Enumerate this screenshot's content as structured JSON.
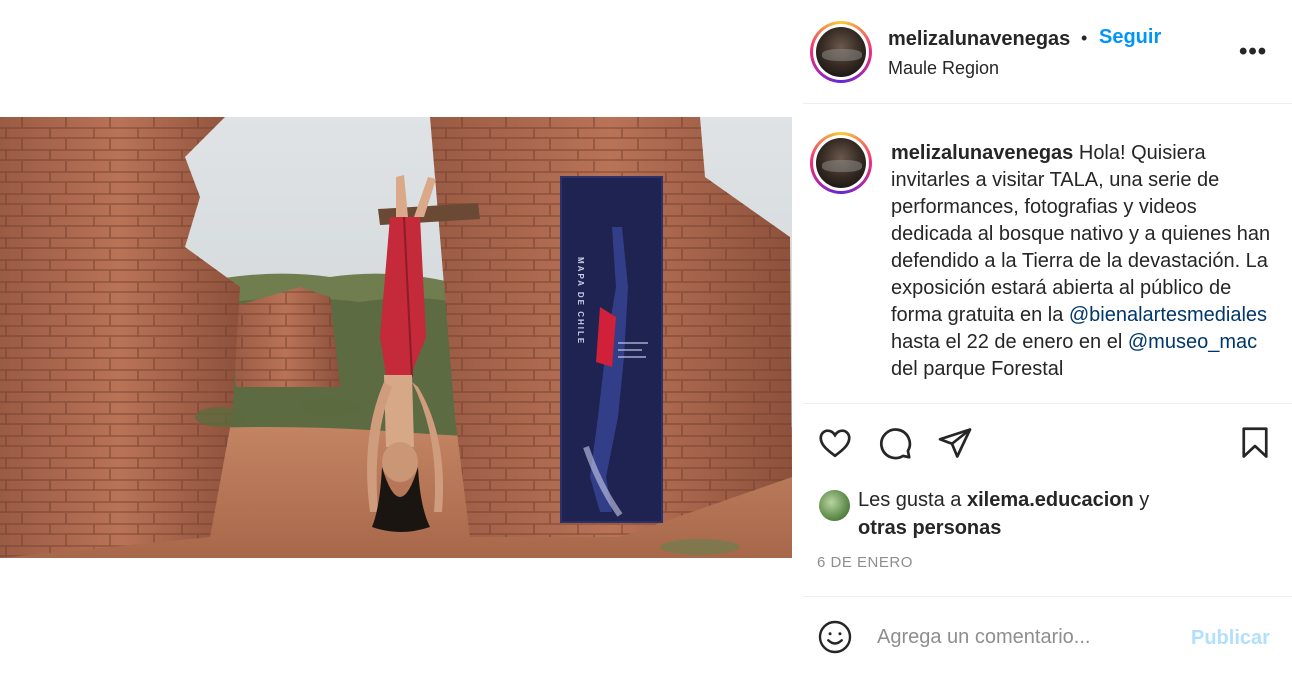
{
  "post": {
    "username": "melizalunavenegas",
    "follow_label": "Seguir",
    "separator": "•",
    "location": "Maule Region",
    "more_label": "•••"
  },
  "caption": {
    "username": "melizalunavenegas",
    "text_part1": " Hola! Quisiera invitarles a visitar TALA, una serie de performances, fotografias y videos dedicada al bosque nativo y a quienes han defendido a la Tierra de la devastación. La exposición estará abierta al público de forma gratuita en la ",
    "mention1": "@bienalartesmediales",
    "text_part2": " hasta el 22 de enero en el ",
    "mention2": "@museo_mac",
    "text_part3": " del parque Forestal"
  },
  "media": {
    "banner_title": "MAPA DE CHILE"
  },
  "likes": {
    "prefix": "Les gusta a ",
    "user": "xilema.educacion",
    "middle": " y",
    "others": "otras personas"
  },
  "date": "6 DE ENERO",
  "comment": {
    "placeholder": "Agrega un comentario...",
    "publish_label": "Publicar"
  },
  "colors": {
    "accent": "#0095f6",
    "link": "#00376b",
    "publish_disabled": "#b2dffc",
    "muted": "#8e8e8e"
  },
  "icons": [
    "heart-icon",
    "comment-icon",
    "share-icon",
    "bookmark-icon",
    "emoji-icon"
  ]
}
